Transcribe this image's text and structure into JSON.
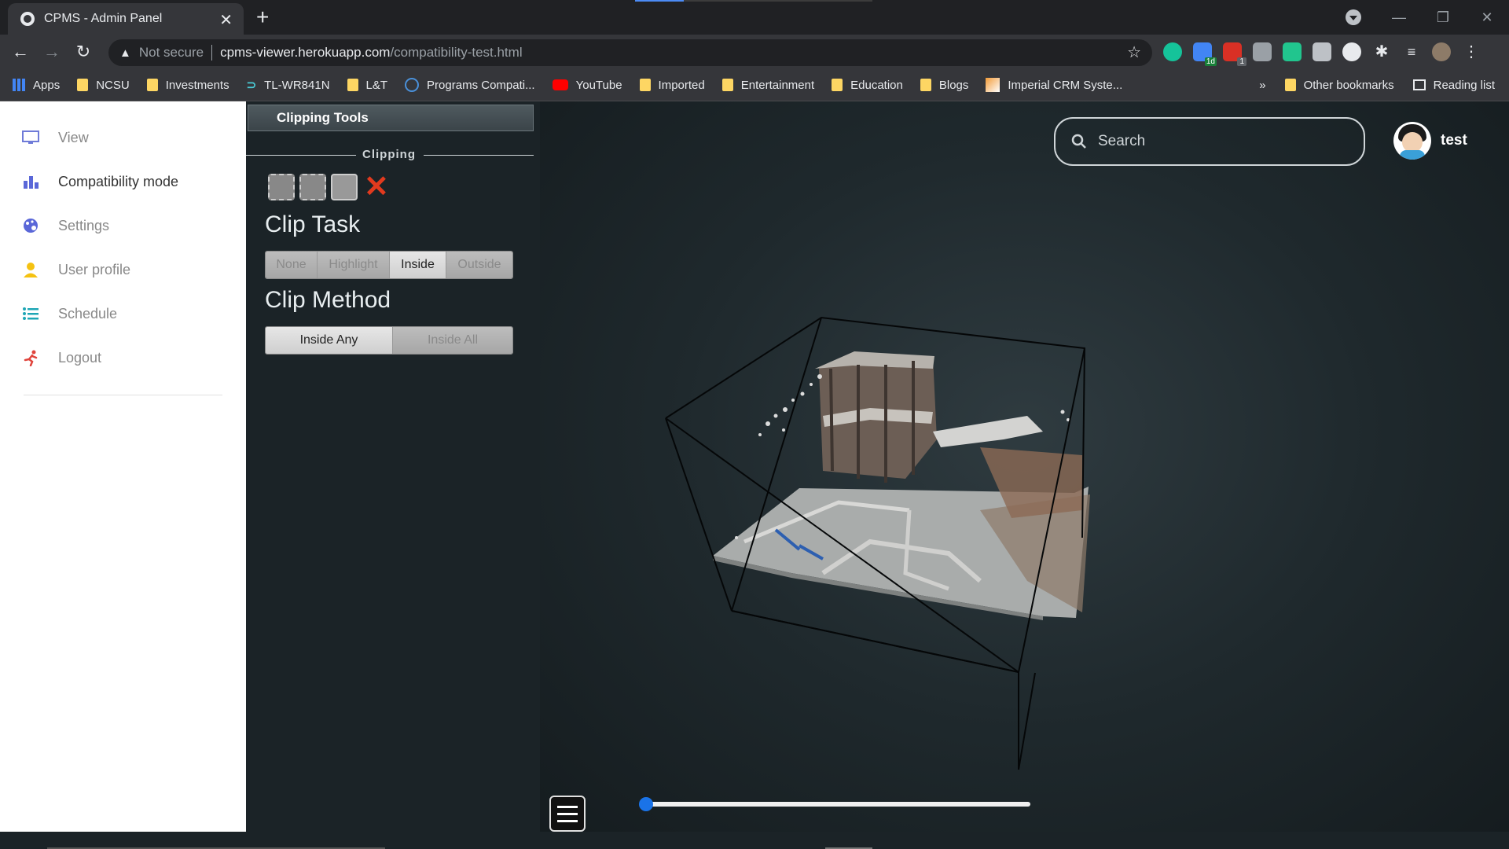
{
  "browser": {
    "tab_title": "CPMS - Admin Panel",
    "url_warning": "Not secure",
    "url_host": "cpms-viewer.herokuapp.com",
    "url_path": "/compatibility-test.html",
    "bookmarks": [
      {
        "label": "Apps",
        "icon": "apps-grid-icon"
      },
      {
        "label": "NCSU",
        "icon": "folder-icon"
      },
      {
        "label": "Investments",
        "icon": "folder-icon"
      },
      {
        "label": "TL-WR841N",
        "icon": "tplink-icon"
      },
      {
        "label": "L&T",
        "icon": "folder-icon"
      },
      {
        "label": "Programs Compati...",
        "icon": "dell-icon"
      },
      {
        "label": "YouTube",
        "icon": "youtube-icon"
      },
      {
        "label": "Imported",
        "icon": "folder-icon"
      },
      {
        "label": "Entertainment",
        "icon": "folder-icon"
      },
      {
        "label": "Education",
        "icon": "folder-icon"
      },
      {
        "label": "Blogs",
        "icon": "folder-icon"
      },
      {
        "label": "Imperial CRM Syste...",
        "icon": "crm-icon"
      }
    ],
    "bookmarks_more": "»",
    "other_bookmarks": "Other bookmarks",
    "reading_list": "Reading list",
    "extension_badges": {
      "calendar": "1d",
      "todo": "1"
    }
  },
  "sidebar": {
    "items": [
      {
        "label": "View",
        "icon": "monitor-icon"
      },
      {
        "label": "Compatibility mode",
        "icon": "chart-building-icon"
      },
      {
        "label": "Settings",
        "icon": "palette-icon"
      },
      {
        "label": "User profile",
        "icon": "user-icon"
      },
      {
        "label": "Schedule",
        "icon": "list-icon"
      },
      {
        "label": "Logout",
        "icon": "running-icon"
      }
    ]
  },
  "panel": {
    "header": "Clipping Tools",
    "section": "Clipping",
    "clip_task_title": "Clip Task",
    "clip_task_options": [
      "None",
      "Highlight",
      "Inside",
      "Outside"
    ],
    "clip_task_selected": "Inside",
    "clip_method_title": "Clip Method",
    "clip_method_options": [
      "Inside Any",
      "Inside All"
    ],
    "clip_method_selected": "Inside Any"
  },
  "viewer": {
    "search_placeholder": "Search",
    "username": "test",
    "slider_value": 0
  },
  "colors": {
    "accent": "#1a73e8",
    "panel_bg": "#1b2327",
    "clip_remove": "#e23a1e"
  }
}
